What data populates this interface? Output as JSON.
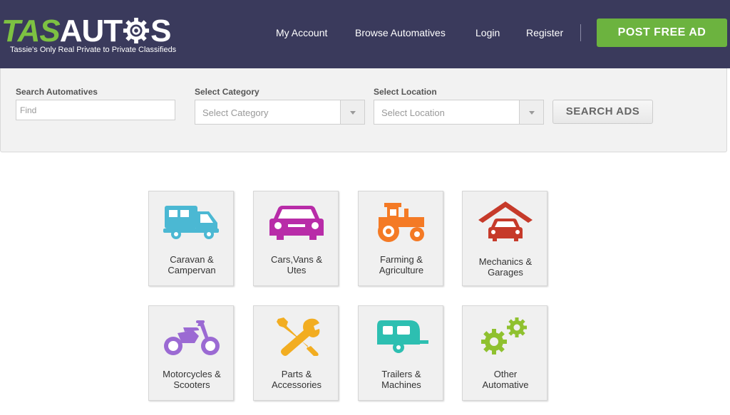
{
  "header": {
    "logo": {
      "part1": "TAS",
      "part2": "AUT",
      "part3": "S",
      "tagline": "Tassie's Only Real Private to Private Classifieds"
    },
    "nav": [
      {
        "label": "My Account"
      },
      {
        "label": "Browse Automatives"
      },
      {
        "label": "Login"
      },
      {
        "label": "Register"
      }
    ],
    "post_button": "POST FREE AD"
  },
  "search": {
    "keyword": {
      "label": "Search Automatives",
      "placeholder": "Find",
      "value": ""
    },
    "category": {
      "label": "Select Category",
      "selected": "Select Category"
    },
    "location": {
      "label": "Select Location",
      "selected": "Select Location"
    },
    "submit": "SEARCH ADS"
  },
  "categories": [
    {
      "line1": "Caravan &",
      "line2": "Campervan",
      "icon": "campervan-icon",
      "color": "#4bb8d3"
    },
    {
      "line1": "Cars,Vans &",
      "line2": "Utes",
      "icon": "car-icon",
      "color": "#b82ca8"
    },
    {
      "line1": "Farming &",
      "line2": "Agriculture",
      "icon": "tractor-icon",
      "color": "#f47a25"
    },
    {
      "line1": "Mechanics &",
      "line2": "Garages",
      "icon": "garage-icon",
      "color": "#c63a2a"
    },
    {
      "line1": "Motorcycles &",
      "line2": "Scooters",
      "icon": "motorcycle-icon",
      "color": "#9b6ad3"
    },
    {
      "line1": "Parts &",
      "line2": "Accessories",
      "icon": "wrench-screwdriver-icon",
      "color": "#f2ad21"
    },
    {
      "line1": "Trailers &",
      "line2": "Machines",
      "icon": "trailer-icon",
      "color": "#2dbfb1"
    },
    {
      "line1": "Other",
      "line2": "Automative",
      "icon": "gears-icon",
      "color": "#8fc12f"
    }
  ],
  "colors": {
    "header_bg": "#3a3a5c",
    "brand_green": "#6cb33f",
    "panel_bg": "#f2f2f2"
  }
}
